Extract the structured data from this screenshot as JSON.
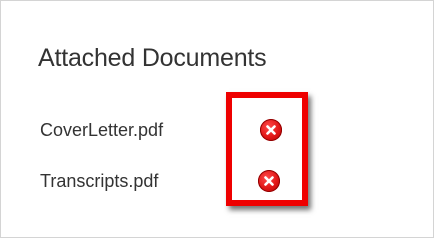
{
  "panel": {
    "title": "Attached Documents"
  },
  "documents": [
    {
      "name": "CoverLetter.pdf",
      "remove_icon": "remove-circle-x-icon"
    },
    {
      "name": "Transcripts.pdf",
      "remove_icon": "remove-circle-x-icon"
    }
  ],
  "colors": {
    "remove_icon": "#e01515",
    "highlight_box": "#ee0000",
    "text": "#333333",
    "panel_border": "#d4d4d4"
  }
}
